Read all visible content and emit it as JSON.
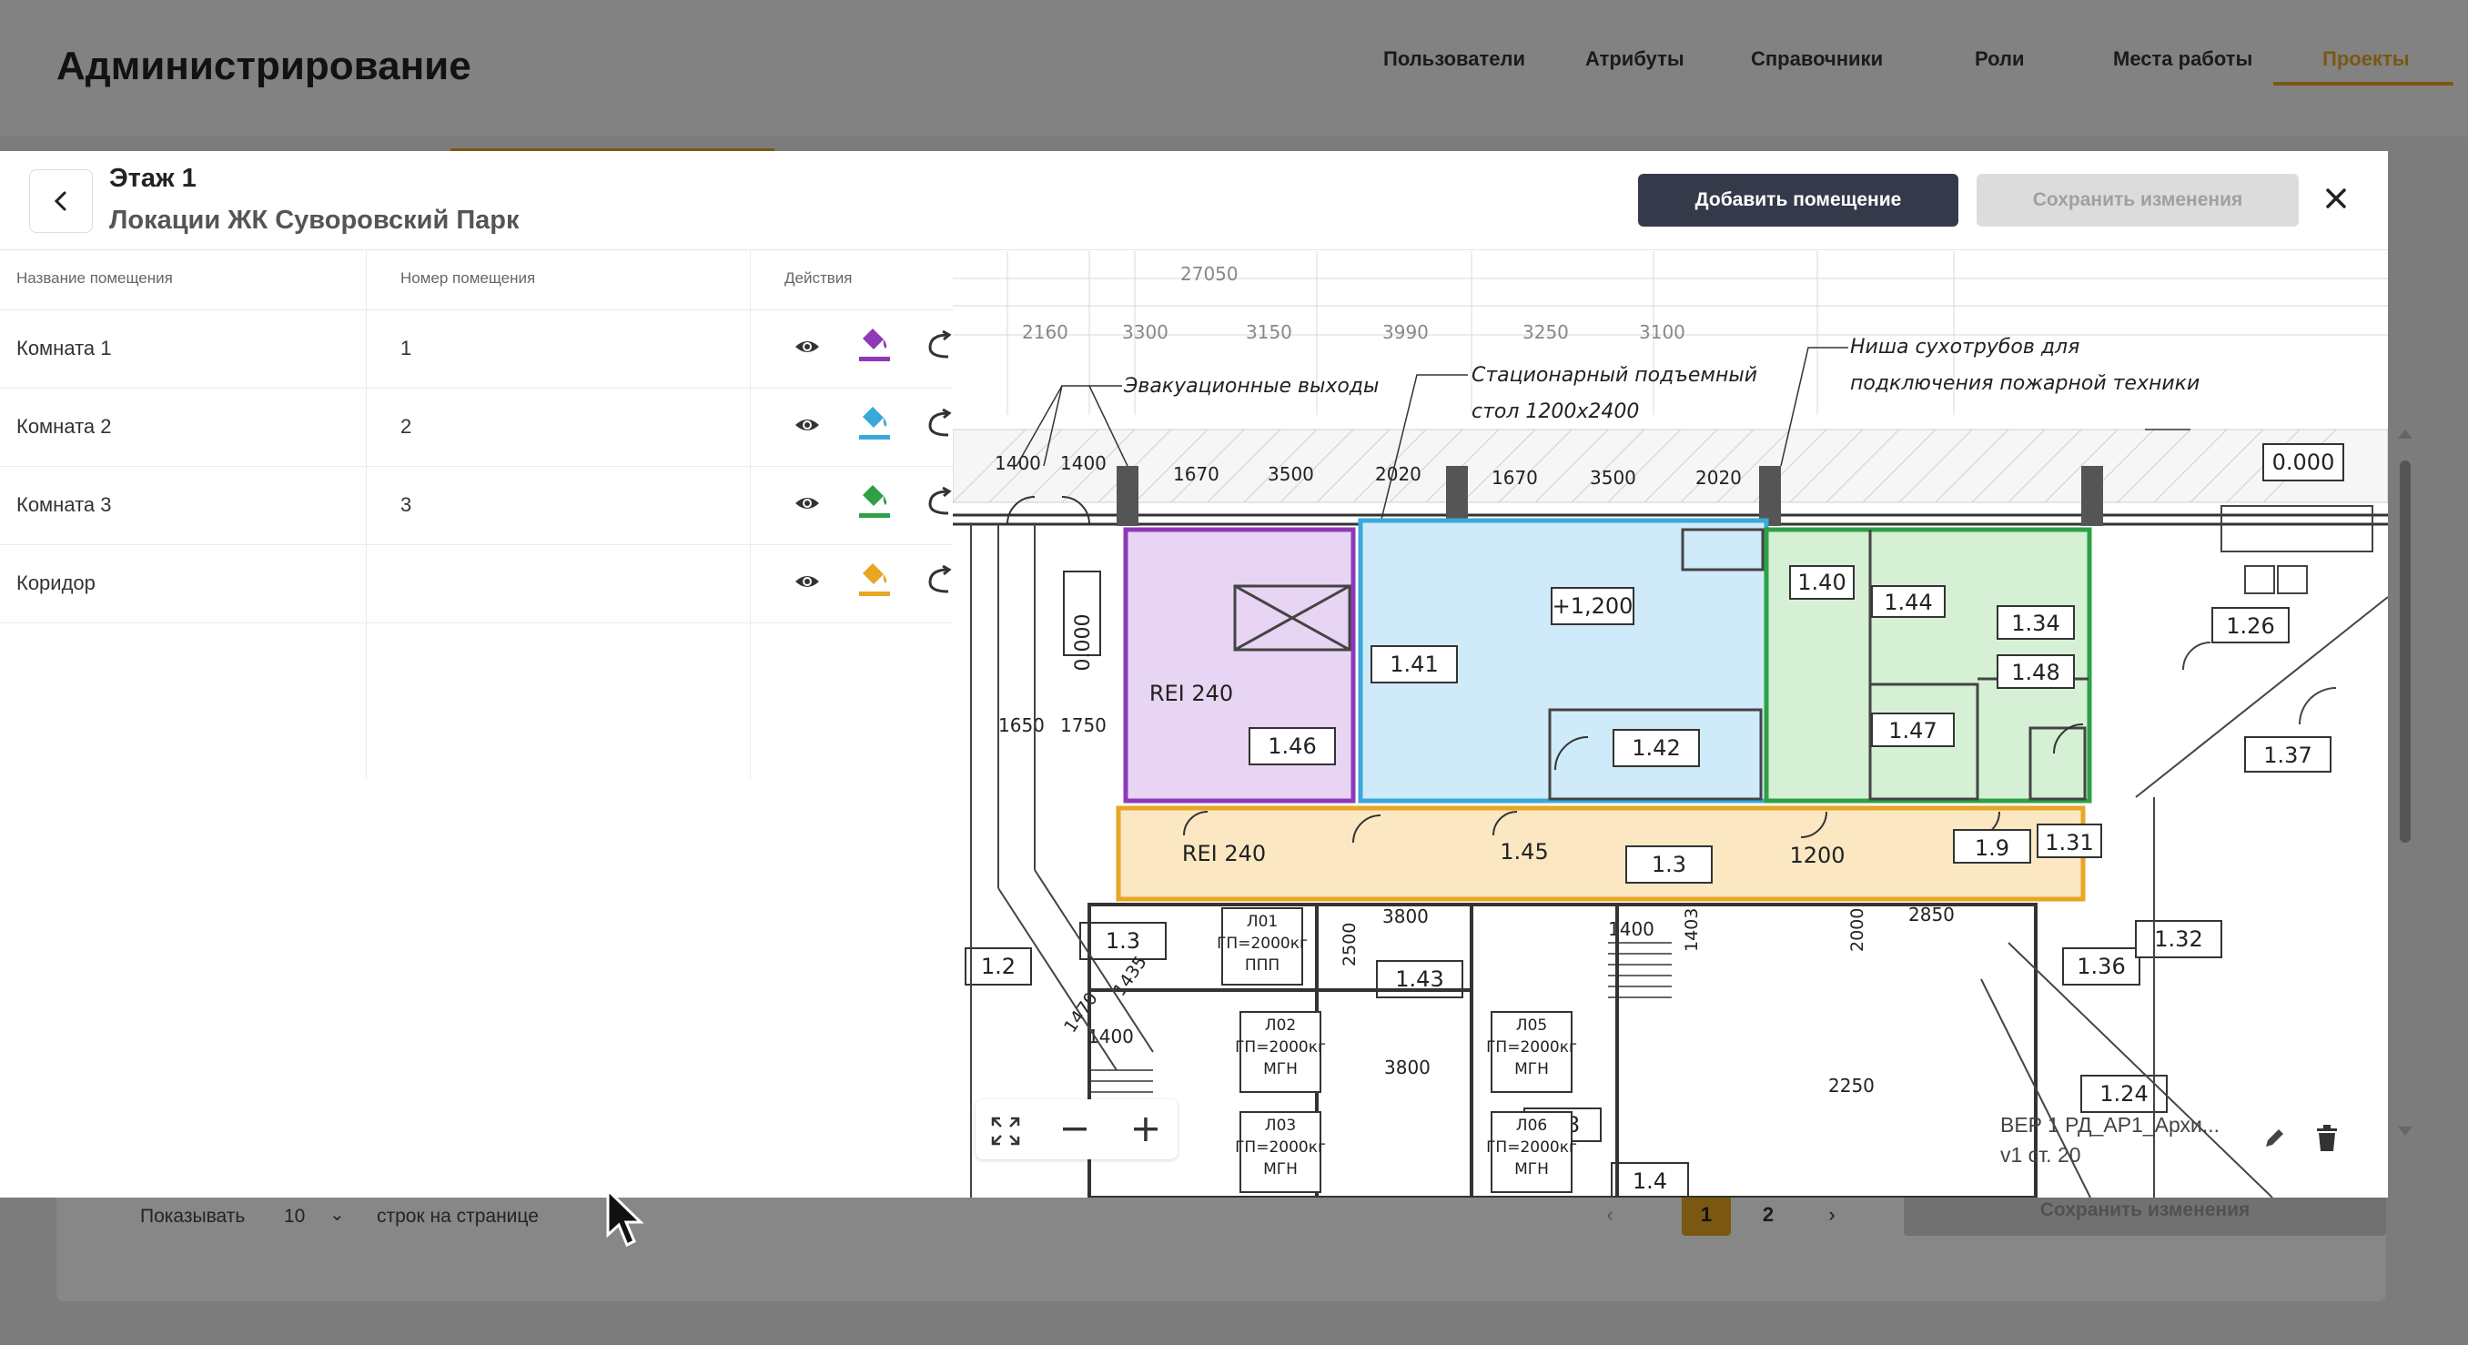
{
  "app": {
    "title": "Администрирование",
    "nav": [
      {
        "label": "Пользователи"
      },
      {
        "label": "Атрибуты"
      },
      {
        "label": "Справочники"
      },
      {
        "label": "Роли"
      },
      {
        "label": "Места работы"
      },
      {
        "label": "Проекты",
        "active": true
      }
    ]
  },
  "background": {
    "show_label": "Показывать",
    "per_page": "10",
    "rows_label": "строк на странице",
    "pages": [
      "1",
      "2"
    ],
    "current_page": "1",
    "save_label": "Сохранить изменения"
  },
  "modal": {
    "floor": "Этаж 1",
    "location": "Локации ЖК Суворовский Парк",
    "add_room_label": "Добавить помещение",
    "save_label": "Сохранить изменения",
    "table": {
      "headers": {
        "name": "Название помещения",
        "number": "Номер помещения",
        "actions": "Действия"
      },
      "rows": [
        {
          "name": "Комната 1",
          "number": "1",
          "color": "#8e3ab8"
        },
        {
          "name": "Комната 2",
          "number": "2",
          "color": "#3aa8d8"
        },
        {
          "name": "Комната 3",
          "number": "3",
          "color": "#2ea046"
        },
        {
          "name": "Коридор",
          "number": "",
          "color": "#e7a623"
        }
      ]
    }
  },
  "plan": {
    "dims_top": [
      "27050",
      "2160",
      "3300",
      "3150",
      "3990",
      "3250",
      "3100"
    ],
    "dims_wall": [
      "1400",
      "1400",
      "1670",
      "3500",
      "2020",
      "1670",
      "3500",
      "2020"
    ],
    "annotations": {
      "evacuation": "Эвакуационные выходы",
      "lift_line1": "Стационарный подъемный",
      "lift_line2": "стол 1200х2400",
      "niche_line1": "Ниша сухотрубов для",
      "niche_line2": "подключения пожарной техники"
    },
    "room_labels": {
      "r146": "1.46",
      "rei1": "REI 240",
      "r141": "1.41",
      "elev": "+1,200",
      "r142": "1.42",
      "r140": "1.40",
      "r144": "1.44",
      "r134": "1.34",
      "r148": "1.48",
      "r147": "1.47",
      "r126": "1.26",
      "r137": "1.37",
      "rei2": "REI 240",
      "r145": "1.45",
      "d1200": "1200",
      "r19": "1.9",
      "r131": "1.31",
      "level": "0.000",
      "vlevel": "0.000",
      "r13": "1.3",
      "r143": "1.43",
      "r12": "1.2",
      "r136": "1.36",
      "r132": "1.32",
      "r18": "1.8",
      "r14": "1.4",
      "r124": "1.24",
      "d3800a": "3800",
      "d3800b": "3800",
      "d2500": "2500",
      "d1400": "1400",
      "d1400b": "1400",
      "d1650": "1650",
      "d1750": "1750",
      "d1470": "1470",
      "d1435": "1435",
      "d2250": "2250",
      "d2000": "2000",
      "d2850": "2850",
      "d1403": "1403",
      "l01a": "Л01",
      "l01b": "ГП=2000кг",
      "l01c": "ППП",
      "l02a": "Л02",
      "l02b": "ГП=2000кг",
      "l02c": "МГН",
      "l03a": "Л03",
      "l03b": "ГП=2000кг",
      "l03c": "МГН",
      "l05a": "Л05",
      "l05b": "ГП=2000кг",
      "l05c": "МГН",
      "l06a": "Л06",
      "l06b": "ГП=2000кг",
      "l06c": "МГН"
    },
    "document": {
      "line1": "BEP 1 РД_АР1_Архи...",
      "line2": "v1 ст. 20"
    }
  },
  "colors": {
    "accent": "#e7a623",
    "dark_button": "#353a4a",
    "purple": "#8e3ab8",
    "blue": "#3aa8d8",
    "green": "#2ea046",
    "orange": "#e7a623"
  }
}
